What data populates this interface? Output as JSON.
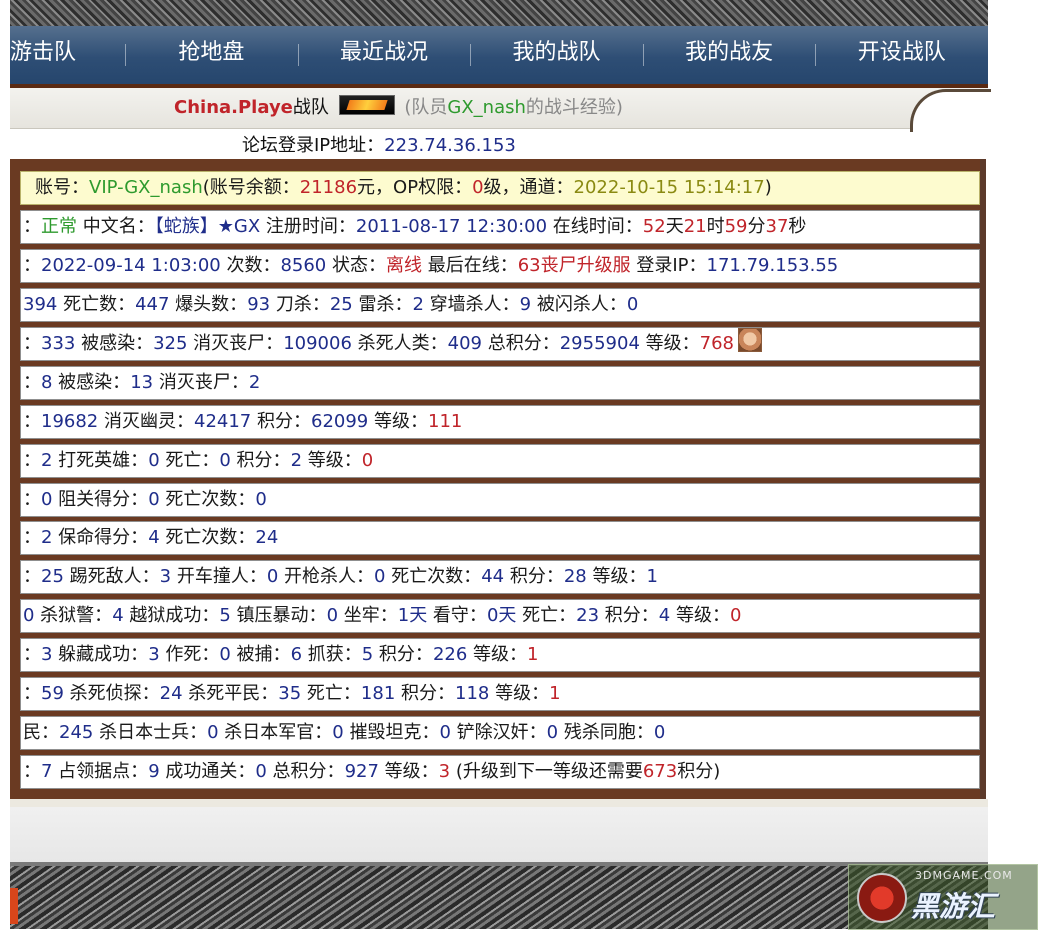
{
  "nav": {
    "items": [
      {
        "label": "游击队"
      },
      {
        "label": "抢地盘"
      },
      {
        "label": "最近战况"
      },
      {
        "label": "我的战队"
      },
      {
        "label": "我的战友"
      },
      {
        "label": "开设战队"
      }
    ]
  },
  "team": {
    "name": "China.Playe",
    "team_word": "战队",
    "logo_icon": "team-logo-icon",
    "subtitle_prefix": "(队员",
    "member_name": "GX_nash",
    "subtitle_suffix": "的战斗经验)"
  },
  "login": {
    "label": "论坛登录IP地址：",
    "ip": "223.74.36.153"
  },
  "account": {
    "p1": "账号：",
    "account_id": "VIP-GX_nash",
    "p2": "(账号余额：",
    "balance": "21186",
    "p3": "元，OP权限：",
    "op_level": "0",
    "p4": "级，通道：",
    "channel_time": "2022-10-15 15:14:17",
    "p5": ")"
  },
  "status_row": {
    "p1": "：",
    "status": "正常",
    "p2": " 中文名：",
    "clan": "【蛇族】",
    "star_name": "★GX",
    "p3": " 注册时间：",
    "register_time": "2011-08-17 12:30:00",
    "p4": " 在线时间：",
    "days": "52",
    "u_day": "天",
    "hours": "21",
    "u_hour": "时",
    "minutes": "59",
    "u_min": "分",
    "seconds": "37",
    "u_sec": "秒"
  },
  "session_row": {
    "p1": "：",
    "date": "2022-09-14 1:03:00",
    "p2": " 次数：",
    "count": "8560",
    "p3": " 状态：",
    "state": "离线",
    "p4": " 最后在线：",
    "last_server": "63丧尸升级服",
    "p5": " 登录IP：",
    "login_ip": "171.79.153.55"
  },
  "kills_row": {
    "v0": "394",
    "l1": " 死亡数：",
    "v1": "447",
    "l2": " 爆头数：",
    "v2": "93",
    "l3": " 刀杀：",
    "v3": "25",
    "l4": " 雷杀：",
    "v4": "2",
    "l5": " 穿墙杀人：",
    "v5": "9",
    "l6": " 被闪杀人：",
    "v6": "0"
  },
  "zombie_row": {
    "p0": "：",
    "v0": "333",
    "l1": " 被感染：",
    "v1": "325",
    "l2": " 消灭丧尸：",
    "v2": "109006",
    "l3": " 杀死人类：",
    "v3": "409",
    "l4": " 总积分：",
    "v4": "2955904",
    "l5": " 等级：",
    "level": "768",
    "avatar_icon": "player-avatar-icon"
  },
  "infect_row": {
    "p0": "：",
    "v0": "8",
    "l1": " 被感染：",
    "v1": "13",
    "l2": " 消灭丧尸：",
    "v2": "2"
  },
  "ghost_row": {
    "p0": "：",
    "v0": "19682",
    "l1": " 消灭幽灵：",
    "v1": "42417",
    "l2": " 积分：",
    "v2": "62099",
    "l3": " 等级：",
    "level": "111"
  },
  "hero_row": {
    "p0": "：",
    "v0": "2",
    "l1": " 打死英雄：",
    "v1": "0",
    "l2": " 死亡：",
    "v2": "0",
    "l3": " 积分：",
    "v3": "2",
    "l4": " 等级：",
    "level": "0"
  },
  "block_row": {
    "p0": "：",
    "v0": "0",
    "l1": " 阻关得分：",
    "v1": "0",
    "l2": " 死亡次数：",
    "v2": "0"
  },
  "save_row": {
    "p0": "：",
    "v0": "2",
    "l1": " 保命得分：",
    "v1": "4",
    "l2": " 死亡次数：",
    "v2": "24"
  },
  "kick_row": {
    "p0": "：",
    "v0": "25",
    "l1": " 踢死敌人：",
    "v1": "3",
    "l2": " 开车撞人：",
    "v2": "0",
    "l3": " 开枪杀人：",
    "v3": "0",
    "l4": " 死亡次数：",
    "v4": "44",
    "l5": " 积分：",
    "v5": "28",
    "l6": " 等级：",
    "level": "1"
  },
  "prison_row": {
    "v0": "0",
    "l1": " 杀狱警：",
    "v1": "4",
    "l2": " 越狱成功：",
    "v2": "5",
    "l3": " 镇压暴动：",
    "v3": "0",
    "l4": " 坐牢：",
    "v4": "1",
    "u4": "天",
    "l5": " 看守：",
    "v5": "0",
    "u5": "天",
    "l6": " 死亡：",
    "v6": "23",
    "l7": " 积分：",
    "v7": "4",
    "l8": " 等级：",
    "level": "0"
  },
  "hide_row": {
    "p0": "：",
    "v0": "3",
    "l1": " 躲藏成功：",
    "v1": "3",
    "l2": " 作死：",
    "v2": "0",
    "l3": " 被捕：",
    "v3": "6",
    "l4": " 抓获：",
    "v4": "5",
    "l5": " 积分：",
    "v5": "226",
    "l6": " 等级：",
    "level": "1"
  },
  "detective_row": {
    "p0": "：",
    "v0": "59",
    "l1": " 杀死侦探：",
    "v1": "24",
    "l2": " 杀死平民：",
    "v2": "35",
    "l3": " 死亡：",
    "v3": "181",
    "l4": " 积分：",
    "v4": "118",
    "l5": " 等级：",
    "level": "1"
  },
  "war_row": {
    "p0": "民：",
    "v0": "245",
    "l1": " 杀日本士兵：",
    "v1": "0",
    "l2": " 杀日本军官：",
    "v2": "0",
    "l3": " 摧毁坦克：",
    "v3": "0",
    "l4": " 铲除汉奸：",
    "v4": "0",
    "l5": " 残杀同胞：",
    "v5": "0"
  },
  "capture_row": {
    "p0": "：",
    "v0": "7",
    "l1": " 占领据点：",
    "v1": "9",
    "l2": " 成功通关：",
    "v2": "0",
    "l3": " 总积分：",
    "v3": "927",
    "l4": " 等级：",
    "level": "3",
    "l5": " (升级到下一等级还需要",
    "needed": "673",
    "l6": "积分)"
  },
  "watermark": {
    "url": "3DMGAME.COM",
    "name": "黑游汇"
  }
}
